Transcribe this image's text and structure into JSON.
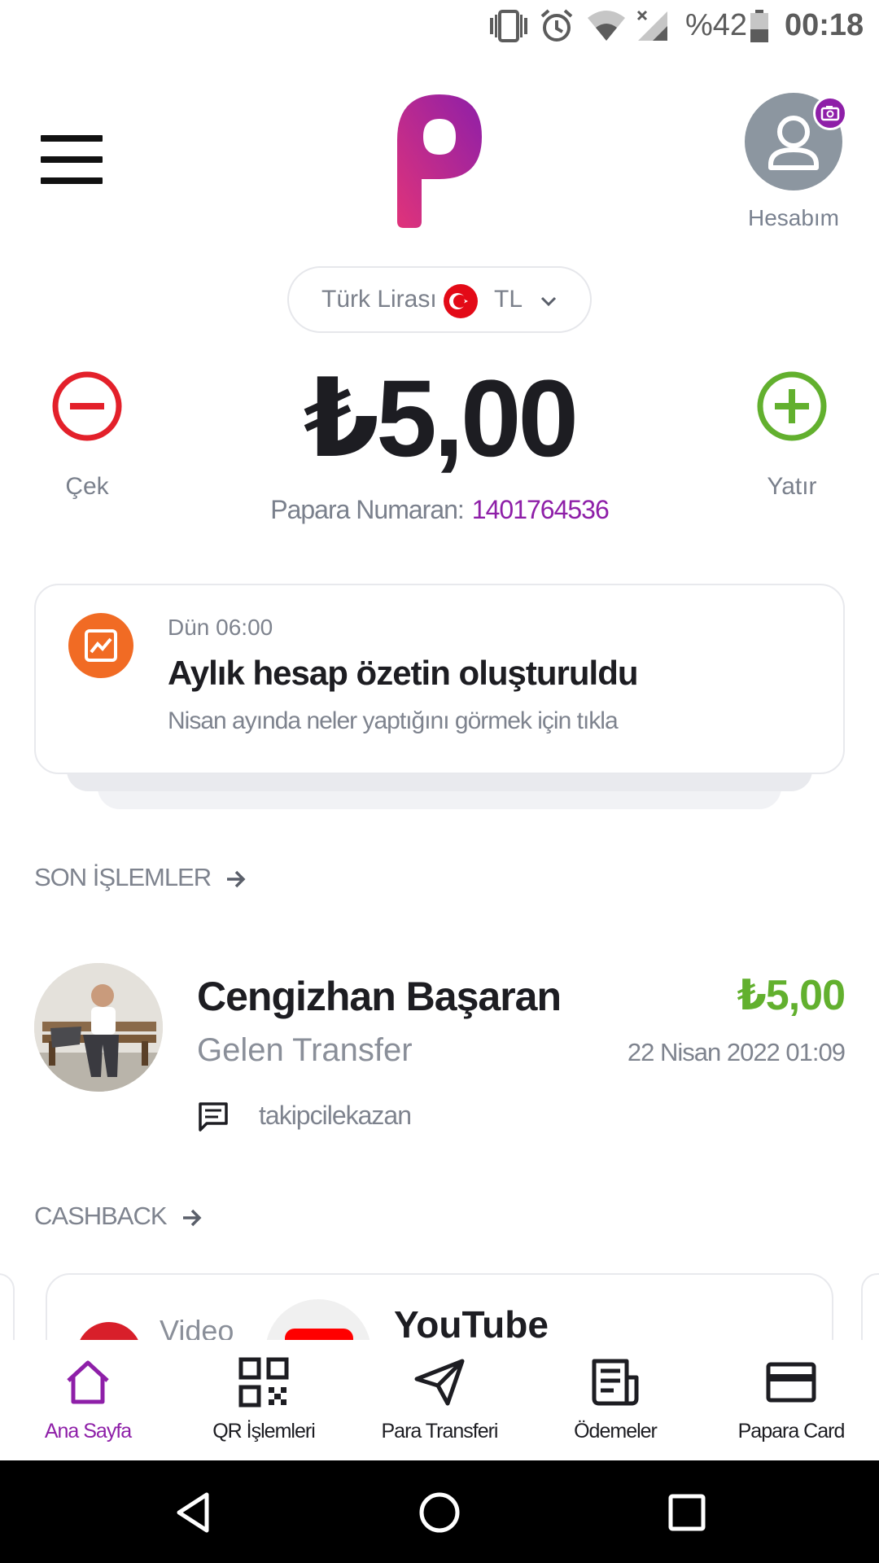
{
  "status_bar": {
    "battery_text": "%42",
    "time": "00:18"
  },
  "header": {
    "account_label": "Hesabım"
  },
  "currency": {
    "name": "Türk Lirası",
    "code": "TL"
  },
  "balance": {
    "amount": "₺5,00",
    "withdraw_label": "Çek",
    "deposit_label": "Yatır",
    "papara_number_label": "Papara Numaran:",
    "papara_number": "1401764536"
  },
  "notification": {
    "time": "Dün 06:00",
    "title": "Aylık hesap özetin oluşturuldu",
    "subtitle": "Nisan ayında neler yaptığını görmek için tıkla"
  },
  "recent": {
    "header": "SON İŞLEMLER",
    "transaction": {
      "name": "Cengizhan Başaran",
      "type": "Gelen Transfer",
      "amount": "₺5,00",
      "date": "22 Nisan 2022 01:09",
      "note": "takipcilekazan"
    }
  },
  "cashback": {
    "header": "CASHBACK",
    "card_label": "Video",
    "card_title": "YouTube"
  },
  "bottom_nav": {
    "items": [
      {
        "label": "Ana Sayfa",
        "icon": "home-icon",
        "active": true
      },
      {
        "label": "QR İşlemleri",
        "icon": "qr-icon",
        "active": false
      },
      {
        "label": "Para Transferi",
        "icon": "send-icon",
        "active": false
      },
      {
        "label": "Ödemeler",
        "icon": "bill-icon",
        "active": false
      },
      {
        "label": "Papara Card",
        "icon": "card-icon",
        "active": false
      }
    ]
  },
  "colors": {
    "brand_purple": "#8e1fa8",
    "brand_pink": "#e0337a",
    "withdraw_red": "#e3202a",
    "deposit_green": "#62b02e",
    "notification_orange": "#f16b24"
  }
}
